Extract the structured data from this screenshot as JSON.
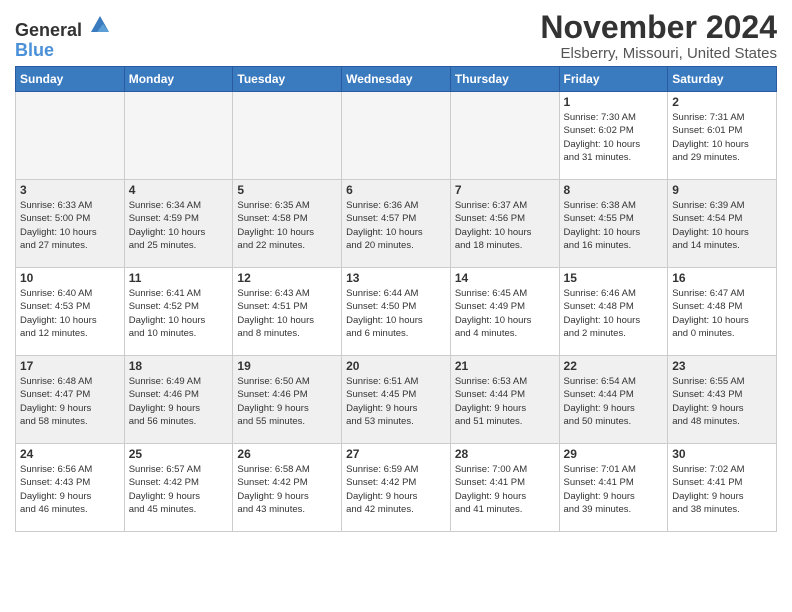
{
  "header": {
    "logo_general": "General",
    "logo_blue": "Blue",
    "title": "November 2024",
    "location": "Elsberry, Missouri, United States"
  },
  "days_of_week": [
    "Sunday",
    "Monday",
    "Tuesday",
    "Wednesday",
    "Thursday",
    "Friday",
    "Saturday"
  ],
  "weeks": [
    [
      {
        "day": "",
        "info": "",
        "empty": true
      },
      {
        "day": "",
        "info": "",
        "empty": true
      },
      {
        "day": "",
        "info": "",
        "empty": true
      },
      {
        "day": "",
        "info": "",
        "empty": true
      },
      {
        "day": "",
        "info": "",
        "empty": true
      },
      {
        "day": "1",
        "info": "Sunrise: 7:30 AM\nSunset: 6:02 PM\nDaylight: 10 hours\nand 31 minutes."
      },
      {
        "day": "2",
        "info": "Sunrise: 7:31 AM\nSunset: 6:01 PM\nDaylight: 10 hours\nand 29 minutes."
      }
    ],
    [
      {
        "day": "3",
        "info": "Sunrise: 6:33 AM\nSunset: 5:00 PM\nDaylight: 10 hours\nand 27 minutes."
      },
      {
        "day": "4",
        "info": "Sunrise: 6:34 AM\nSunset: 4:59 PM\nDaylight: 10 hours\nand 25 minutes."
      },
      {
        "day": "5",
        "info": "Sunrise: 6:35 AM\nSunset: 4:58 PM\nDaylight: 10 hours\nand 22 minutes."
      },
      {
        "day": "6",
        "info": "Sunrise: 6:36 AM\nSunset: 4:57 PM\nDaylight: 10 hours\nand 20 minutes."
      },
      {
        "day": "7",
        "info": "Sunrise: 6:37 AM\nSunset: 4:56 PM\nDaylight: 10 hours\nand 18 minutes."
      },
      {
        "day": "8",
        "info": "Sunrise: 6:38 AM\nSunset: 4:55 PM\nDaylight: 10 hours\nand 16 minutes."
      },
      {
        "day": "9",
        "info": "Sunrise: 6:39 AM\nSunset: 4:54 PM\nDaylight: 10 hours\nand 14 minutes."
      }
    ],
    [
      {
        "day": "10",
        "info": "Sunrise: 6:40 AM\nSunset: 4:53 PM\nDaylight: 10 hours\nand 12 minutes."
      },
      {
        "day": "11",
        "info": "Sunrise: 6:41 AM\nSunset: 4:52 PM\nDaylight: 10 hours\nand 10 minutes."
      },
      {
        "day": "12",
        "info": "Sunrise: 6:43 AM\nSunset: 4:51 PM\nDaylight: 10 hours\nand 8 minutes."
      },
      {
        "day": "13",
        "info": "Sunrise: 6:44 AM\nSunset: 4:50 PM\nDaylight: 10 hours\nand 6 minutes."
      },
      {
        "day": "14",
        "info": "Sunrise: 6:45 AM\nSunset: 4:49 PM\nDaylight: 10 hours\nand 4 minutes."
      },
      {
        "day": "15",
        "info": "Sunrise: 6:46 AM\nSunset: 4:48 PM\nDaylight: 10 hours\nand 2 minutes."
      },
      {
        "day": "16",
        "info": "Sunrise: 6:47 AM\nSunset: 4:48 PM\nDaylight: 10 hours\nand 0 minutes."
      }
    ],
    [
      {
        "day": "17",
        "info": "Sunrise: 6:48 AM\nSunset: 4:47 PM\nDaylight: 9 hours\nand 58 minutes."
      },
      {
        "day": "18",
        "info": "Sunrise: 6:49 AM\nSunset: 4:46 PM\nDaylight: 9 hours\nand 56 minutes."
      },
      {
        "day": "19",
        "info": "Sunrise: 6:50 AM\nSunset: 4:46 PM\nDaylight: 9 hours\nand 55 minutes."
      },
      {
        "day": "20",
        "info": "Sunrise: 6:51 AM\nSunset: 4:45 PM\nDaylight: 9 hours\nand 53 minutes."
      },
      {
        "day": "21",
        "info": "Sunrise: 6:53 AM\nSunset: 4:44 PM\nDaylight: 9 hours\nand 51 minutes."
      },
      {
        "day": "22",
        "info": "Sunrise: 6:54 AM\nSunset: 4:44 PM\nDaylight: 9 hours\nand 50 minutes."
      },
      {
        "day": "23",
        "info": "Sunrise: 6:55 AM\nSunset: 4:43 PM\nDaylight: 9 hours\nand 48 minutes."
      }
    ],
    [
      {
        "day": "24",
        "info": "Sunrise: 6:56 AM\nSunset: 4:43 PM\nDaylight: 9 hours\nand 46 minutes."
      },
      {
        "day": "25",
        "info": "Sunrise: 6:57 AM\nSunset: 4:42 PM\nDaylight: 9 hours\nand 45 minutes."
      },
      {
        "day": "26",
        "info": "Sunrise: 6:58 AM\nSunset: 4:42 PM\nDaylight: 9 hours\nand 43 minutes."
      },
      {
        "day": "27",
        "info": "Sunrise: 6:59 AM\nSunset: 4:42 PM\nDaylight: 9 hours\nand 42 minutes."
      },
      {
        "day": "28",
        "info": "Sunrise: 7:00 AM\nSunset: 4:41 PM\nDaylight: 9 hours\nand 41 minutes."
      },
      {
        "day": "29",
        "info": "Sunrise: 7:01 AM\nSunset: 4:41 PM\nDaylight: 9 hours\nand 39 minutes."
      },
      {
        "day": "30",
        "info": "Sunrise: 7:02 AM\nSunset: 4:41 PM\nDaylight: 9 hours\nand 38 minutes."
      }
    ]
  ]
}
